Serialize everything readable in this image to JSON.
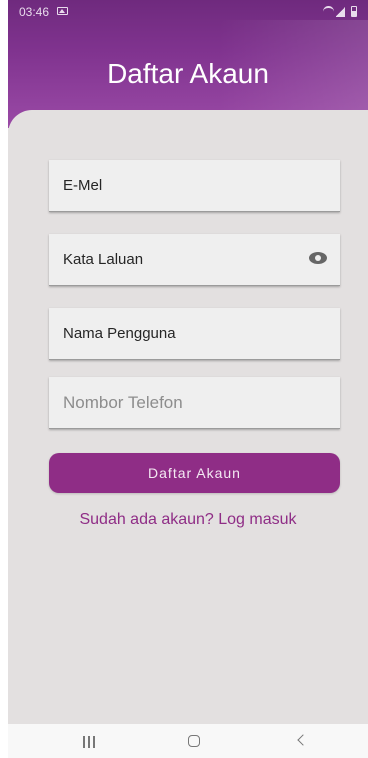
{
  "status_bar": {
    "time": "03:46",
    "icons": [
      "gallery-icon",
      "wifi-icon",
      "signal-icon",
      "battery-icon"
    ]
  },
  "header": {
    "title": "Daftar Akaun"
  },
  "form": {
    "email_value": "E-Mel",
    "password_value": "Kata Laluan",
    "username_value": "Nama Pengguna",
    "phone_placeholder": "Nombor Telefon",
    "show_password_icon": "eye-icon"
  },
  "actions": {
    "submit_label": "Daftar Akaun",
    "login_link": "Sudah ada akaun? Log masuk"
  },
  "navigation": {
    "icons": [
      "recent-apps-icon",
      "home-icon",
      "back-icon"
    ]
  },
  "colors": {
    "accent": "#8f2d86",
    "header": "#80338f",
    "background": "#e3e0e0"
  }
}
